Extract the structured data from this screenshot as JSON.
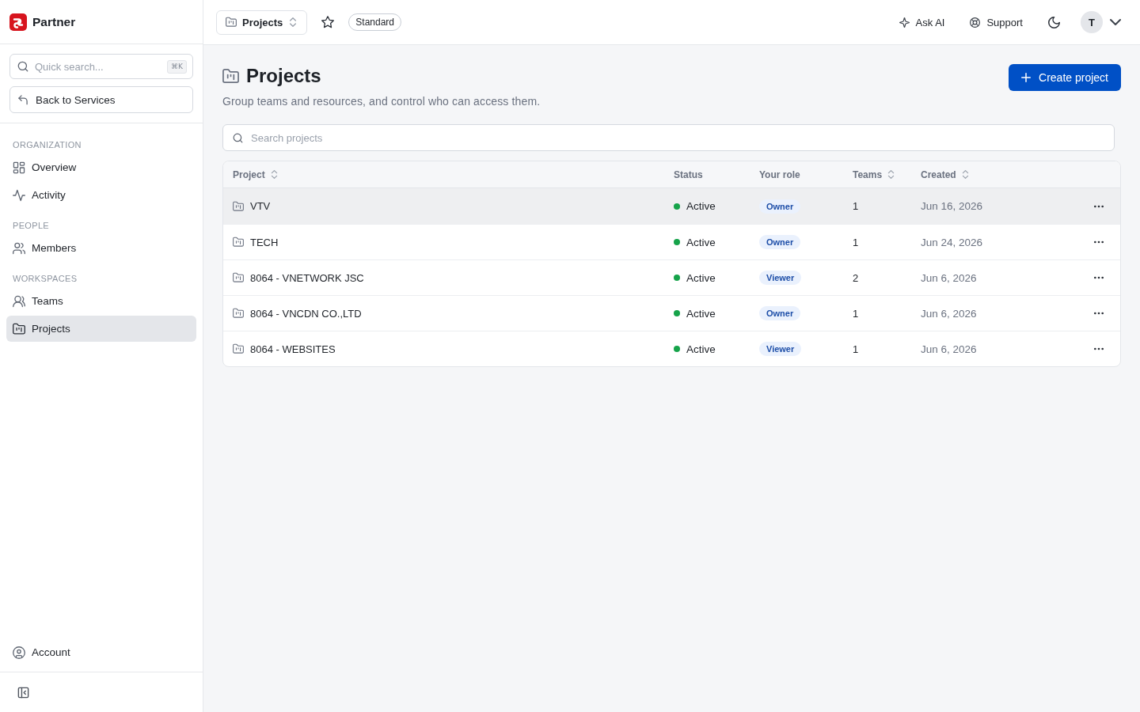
{
  "sidebar": {
    "brand": "Partner",
    "quick_search": {
      "placeholder": "Quick search...",
      "shortcut": "⌘K"
    },
    "back_button": "Back to Services",
    "sections": [
      {
        "title": "ORGANIZATION",
        "items": [
          {
            "label": "Overview",
            "selected": false
          },
          {
            "label": "Activity",
            "selected": false
          }
        ]
      },
      {
        "title": "PEOPLE",
        "items": [
          {
            "label": "Members",
            "selected": false
          }
        ]
      },
      {
        "title": "WORKSPACES",
        "items": [
          {
            "label": "Teams",
            "selected": false
          },
          {
            "label": "Projects",
            "selected": true
          }
        ]
      }
    ],
    "footer_items": [
      {
        "label": "Account",
        "selected": false
      }
    ]
  },
  "top_bar": {
    "context_switcher": "Projects",
    "starred": false,
    "plan_badge": "Standard",
    "actions": [
      {
        "label": "Ask AI"
      },
      {
        "label": "Support"
      }
    ],
    "avatar_initial": "T"
  },
  "page": {
    "title": "Projects",
    "subtitle": "Group teams and resources, and control who can access them.",
    "create_button": "Create project",
    "search": {
      "placeholder": "Search projects"
    },
    "table": {
      "columns": [
        {
          "label": "Project",
          "sortable": true
        },
        {
          "label": "Status",
          "sortable": false
        },
        {
          "label": "Your role",
          "sortable": false
        },
        {
          "label": "Teams",
          "sortable": true
        },
        {
          "label": "Created",
          "sortable": true
        }
      ],
      "rows": [
        {
          "project": "VTV",
          "status": "Active",
          "role": "Owner",
          "teams": "1",
          "created": "Jun 16, 2026",
          "hovered": true
        },
        {
          "project": "TECH",
          "status": "Active",
          "role": "Owner",
          "teams": "1",
          "created": "Jun 24, 2026",
          "hovered": false
        },
        {
          "project": "8064 - VNETWORK JSC",
          "status": "Active",
          "role": "Viewer",
          "teams": "2",
          "created": "Jun 6, 2026",
          "hovered": false
        },
        {
          "project": "8064 - VNCDN CO.,LTD",
          "status": "Active",
          "role": "Owner",
          "teams": "1",
          "created": "Jun 6, 2026",
          "hovered": false
        },
        {
          "project": "8064 - WEBSITES",
          "status": "Active",
          "role": "Viewer",
          "teams": "1",
          "created": "Jun 6, 2026",
          "hovered": false
        }
      ]
    }
  }
}
